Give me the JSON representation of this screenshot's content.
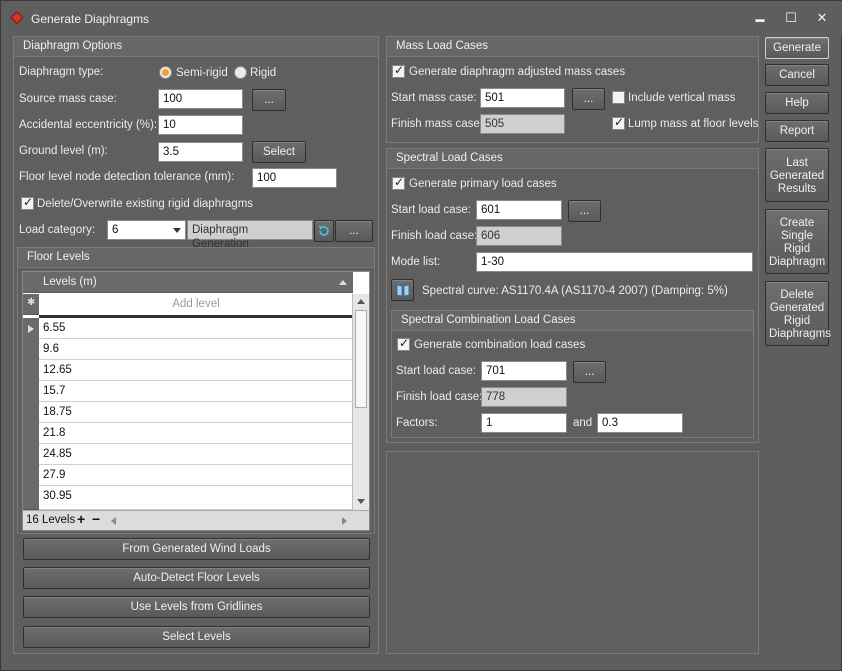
{
  "window": {
    "title": "Generate Diaphragms",
    "minimize_glyph": "▬",
    "maximize_glyph": "☐",
    "close_glyph": "✕"
  },
  "diaphragm_options": {
    "heading": "Diaphragm Options",
    "type_label": "Diaphragm type:",
    "type_options": [
      "Semi-rigid",
      "Rigid"
    ],
    "type_selected": "Semi-rigid",
    "source_mass_label": "Source mass case:",
    "source_mass_value": "100",
    "accidental_label": "Accidental eccentricity (%):",
    "accidental_value": "10",
    "ground_label": "Ground level (m):",
    "ground_value": "3.5",
    "select_button": "Select",
    "tolerance_label": "Floor level node detection tolerance (mm):",
    "tolerance_value": "100",
    "overwrite_label": "Delete/Overwrite existing rigid diaphragms",
    "overwrite_checked": true,
    "load_category_label": "Load category:",
    "load_category_value": "6",
    "load_category_name": "Diaphragm Generation",
    "ellipsis": "..."
  },
  "floor_levels": {
    "heading": "Floor Levels",
    "column_header": "Levels (m)",
    "add_placeholder": "Add level",
    "rows": [
      "6.55",
      "9.6",
      "12.65",
      "15.7",
      "18.75",
      "21.8",
      "24.85",
      "27.9",
      "30.95"
    ],
    "count_label": "16 Levels",
    "add_glyph": "+",
    "remove_glyph": "−",
    "buttons": [
      "From Generated Wind Loads",
      "Auto-Detect Floor Levels",
      "Use Levels from Gridlines",
      "Select Levels"
    ]
  },
  "mass_load_cases": {
    "heading": "Mass Load Cases",
    "generate_label": "Generate diaphragm adjusted mass cases",
    "generate_checked": true,
    "start_label": "Start mass case:",
    "start_value": "501",
    "finish_label": "Finish mass case:",
    "finish_value": "505",
    "include_vertical_label": "Include vertical mass",
    "include_vertical_checked": false,
    "lump_label": "Lump mass at floor levels",
    "lump_checked": true
  },
  "spectral_load_cases": {
    "heading": "Spectral Load Cases",
    "generate_label": "Generate primary load cases",
    "generate_checked": true,
    "start_label": "Start load case:",
    "start_value": "601",
    "finish_label": "Finish load case:",
    "finish_value": "606",
    "mode_label": "Mode list:",
    "mode_value": "1-30",
    "curve_text": "Spectral curve: AS1170.4A (AS1170-4 2007) (Damping: 5%)"
  },
  "spectral_combination": {
    "heading": "Spectral Combination Load Cases",
    "generate_label": "Generate combination load cases",
    "generate_checked": true,
    "start_label": "Start load case:",
    "start_value": "701",
    "finish_label": "Finish load case:",
    "finish_value": "778",
    "factors_label": "Factors:",
    "factor1": "1",
    "and_label": "and",
    "factor2": "0.3"
  },
  "side_buttons": {
    "generate": "Generate",
    "cancel": "Cancel",
    "help": "Help",
    "report": "Report",
    "last_results": "Last Generated Results",
    "create_single": "Create Single Rigid Diaphragm",
    "delete_generated": "Delete Generated Rigid Diaphragms"
  },
  "colors": {
    "accent_radio": "#f0a030",
    "panel": "#5f5f5f",
    "background": "#5e5e5e"
  }
}
